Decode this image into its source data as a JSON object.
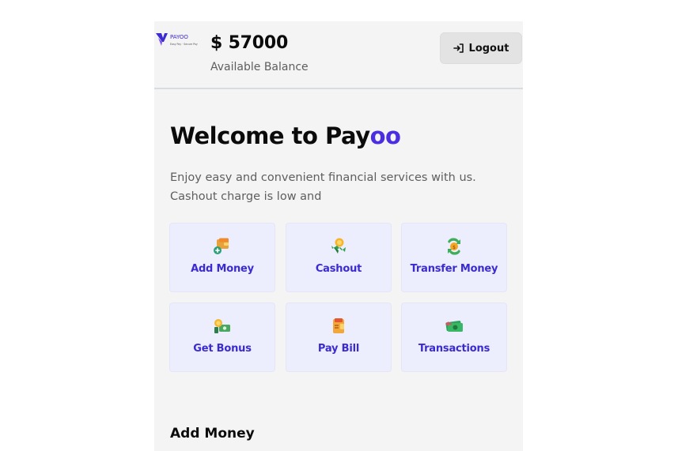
{
  "header": {
    "logo_text": "PAYOO",
    "logo_tagline": "Easy Pay · Secure Pay",
    "balance": "$ 57000",
    "balance_label": "Available Balance",
    "logout_label": "Logout"
  },
  "welcome": {
    "title_prefix": "Welcome to Pay",
    "title_accent": "oo",
    "intro": "Enjoy easy and convenient financial services with us. Cashout charge is low and"
  },
  "services": [
    {
      "label": "Add Money",
      "icon": "wallet-add-icon"
    },
    {
      "label": "Cashout",
      "icon": "cashout-icon"
    },
    {
      "label": "Transfer Money",
      "icon": "transfer-money-icon"
    },
    {
      "label": "Get Bonus",
      "icon": "bonus-icon"
    },
    {
      "label": "Pay Bill",
      "icon": "bill-icon"
    },
    {
      "label": "Transactions",
      "icon": "transactions-icon"
    }
  ],
  "section": {
    "title": "Add Money"
  },
  "colors": {
    "accent": "#4a2ee0",
    "card_label": "#3b2bd0",
    "card_bg": "#ecedfd"
  }
}
